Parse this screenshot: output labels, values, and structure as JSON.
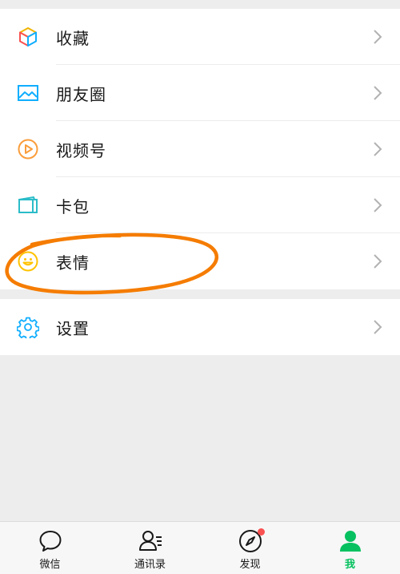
{
  "menu": {
    "items": [
      {
        "label": "收藏",
        "icon": "cube-icon"
      },
      {
        "label": "朋友圈",
        "icon": "image-icon"
      },
      {
        "label": "视频号",
        "icon": "play-circle-icon"
      },
      {
        "label": "卡包",
        "icon": "card-wallet-icon"
      },
      {
        "label": "表情",
        "icon": "smiley-icon"
      }
    ],
    "settings": {
      "label": "设置",
      "icon": "gear-icon"
    }
  },
  "tabbar": {
    "tabs": [
      {
        "label": "微信",
        "icon": "chat-bubble-icon"
      },
      {
        "label": "通讯录",
        "icon": "contacts-icon"
      },
      {
        "label": "发现",
        "icon": "compass-icon"
      },
      {
        "label": "我",
        "icon": "person-icon"
      }
    ],
    "active_index": 3
  },
  "colors": {
    "accent": "#07c160",
    "annotation": "#f57c00",
    "badge": "#fa5151"
  }
}
